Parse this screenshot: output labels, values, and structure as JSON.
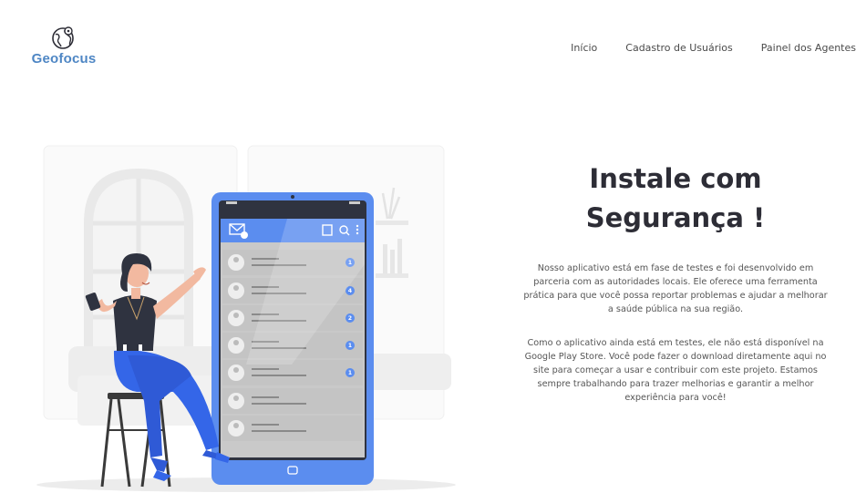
{
  "brand": {
    "name": "Geofocus",
    "icon": "globe-marker-icon",
    "color": "#4e86c4"
  },
  "nav": {
    "items": [
      "Início",
      "Cadastro de Usuários",
      "Painel dos Agentes"
    ]
  },
  "hero": {
    "title_line1": "Instale com",
    "title_line2": "Segurança !",
    "paragraph1": "Nosso aplicativo está em fase de testes e foi desenvolvido em parceria com as autoridades locais. Ele oferece uma ferramenta prática para que você possa reportar problemas e ajudar a melhorar a saúde pública na sua região.",
    "paragraph2": "Como o aplicativo ainda está em testes, ele não está disponível na Google Play Store. Você pode fazer o download diretamente aqui no site para começar a usar e contribuir com este projeto. Estamos sempre trabalhando para trazer melhorias e garantir a melhor experiência para você!"
  },
  "illustration": {
    "description_icon": "woman-with-phone-illustration",
    "phone_badges": [
      "1",
      "4",
      "2",
      "1",
      "1"
    ],
    "accent": "#5b8def"
  }
}
